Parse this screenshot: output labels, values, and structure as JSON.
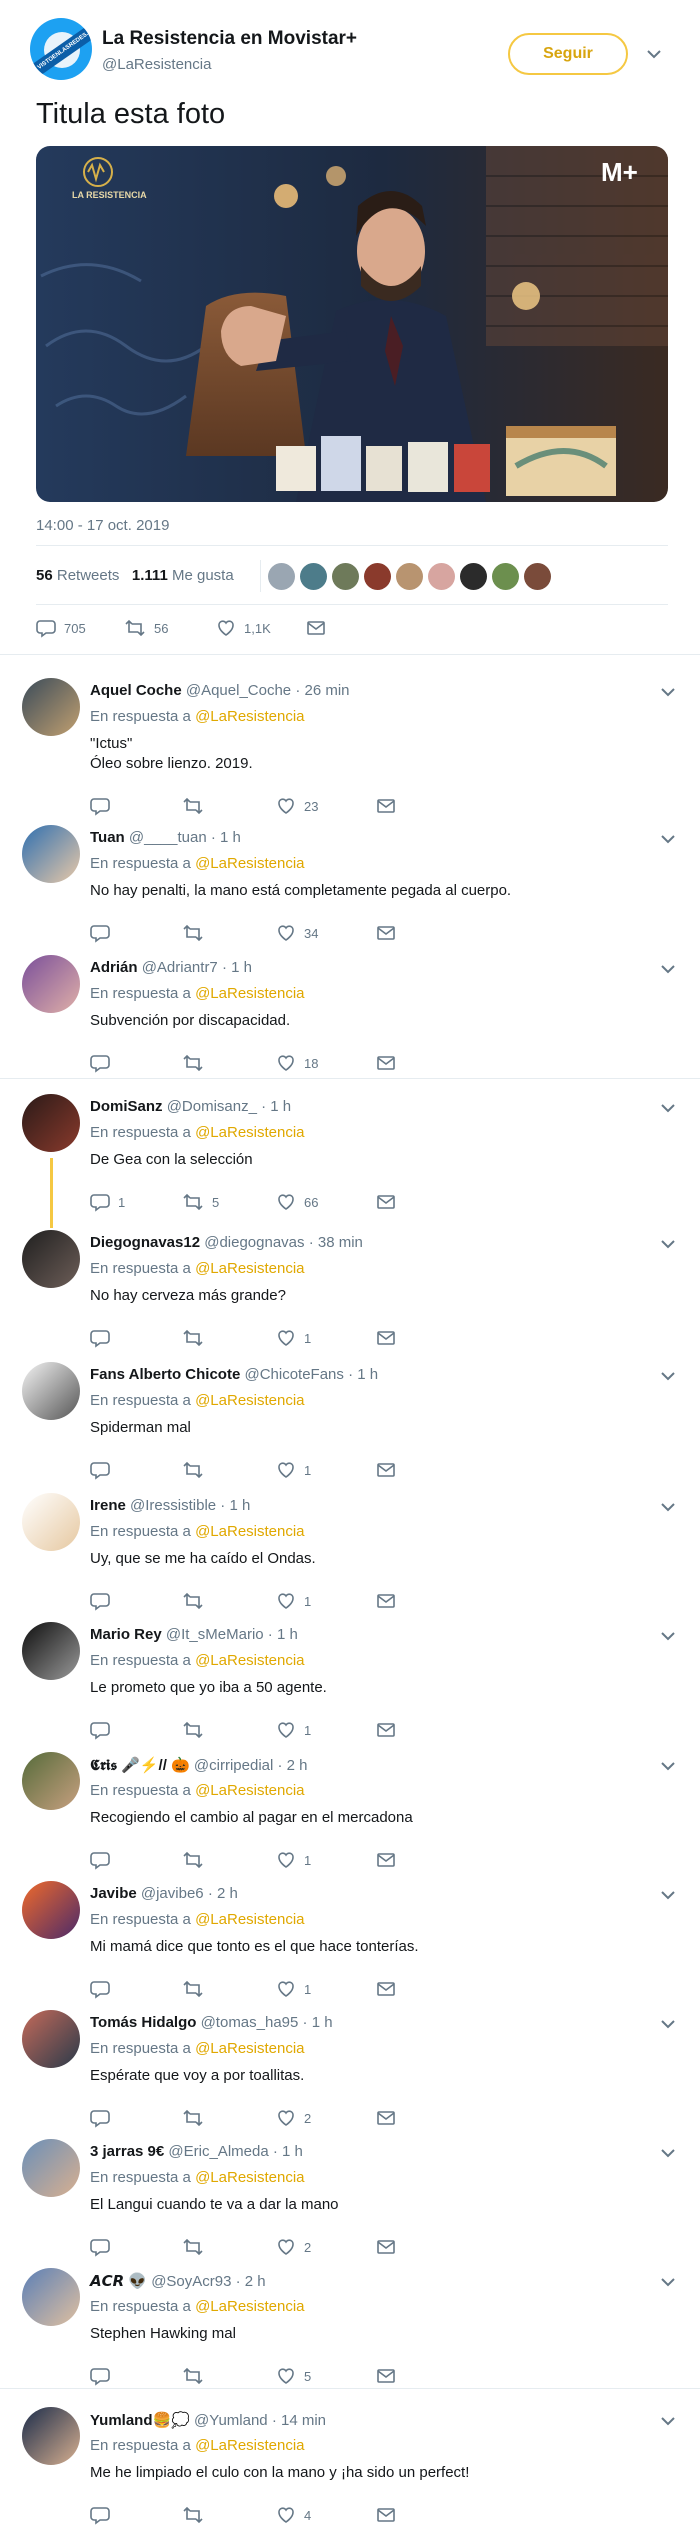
{
  "header": {
    "account_name": "La Resistencia en Movistar+",
    "handle": "@LaResistencia",
    "follow_label": "Seguir",
    "avatar_text": "VISTOENLASREDES.COM",
    "avatar_icon": "la-resistencia-logo"
  },
  "tweet": {
    "text": "Titula esta foto",
    "photo_brand": "LA RESISTENCIA",
    "photo_corner_logo": "M+",
    "timestamp": "14:00 - 17 oct. 2019",
    "retweets_count": "56",
    "retweets_label": "Retweets",
    "likes_count": "1.111",
    "likes_label": "Me gusta",
    "replies_action": "705",
    "retweets_action": "56",
    "likes_action": "1,1K"
  },
  "colors": {
    "accent": "#e0a800",
    "follow_border": "#f5c842",
    "text_primary": "#14171a",
    "text_secondary": "#657786",
    "separator": "#e6ecf0"
  },
  "in_reply_label": "En respuesta a",
  "mention": "@LaResistencia",
  "replies": [
    {
      "name": "Aquel Coche",
      "handle": "@Aquel_Coche",
      "time": "· 26 min",
      "lines": [
        "\"Ictus\"",
        "Óleo sobre lienzo. 2019."
      ],
      "replies": "",
      "retweets": "",
      "likes": "23"
    },
    {
      "name": "Tuan",
      "handle": "@____tuan",
      "time": "· 1 h",
      "lines": [
        "No hay penalti, la mano está completamente pegada al cuerpo."
      ],
      "replies": "",
      "retweets": "",
      "likes": "34"
    },
    {
      "name": "Adrián",
      "handle": "@Adriantr7",
      "time": "· 1 h",
      "lines": [
        "Subvención por discapacidad."
      ],
      "replies": "",
      "retweets": "",
      "likes": "18"
    },
    {
      "name": "DomiSanz",
      "handle": "@Domisanz_",
      "time": "· 1 h",
      "lines": [
        "De Gea con la selección"
      ],
      "replies": "1",
      "retweets": "5",
      "likes": "66"
    },
    {
      "name": "Diegognavas12",
      "handle": "@diegognavas",
      "time": "· 38 min",
      "lines": [
        "No hay cerveza más grande?"
      ],
      "replies": "",
      "retweets": "",
      "likes": "1"
    },
    {
      "name": "Fans Alberto Chicote",
      "handle": "@ChicoteFans",
      "time": "· 1 h",
      "lines": [
        "Spiderman mal"
      ],
      "replies": "",
      "retweets": "",
      "likes": "1"
    },
    {
      "name": "Irene",
      "handle": "@Iressistible",
      "time": "· 1 h",
      "lines": [
        "Uy, que se me ha caído el Ondas."
      ],
      "replies": "",
      "retweets": "",
      "likes": "1"
    },
    {
      "name": "Mario Rey",
      "handle": "@It_sMeMario",
      "time": "· 1 h",
      "lines": [
        "Le prometo que yo iba a 50 agente."
      ],
      "replies": "",
      "retweets": "",
      "likes": "1"
    },
    {
      "name": "𝕮𝖗𝖎𝖘 🎤⚡️// 🎃",
      "handle": "@cirripedial",
      "time": "· 2 h",
      "lines": [
        "Recogiendo el cambio al pagar en el mercadona"
      ],
      "replies": "",
      "retweets": "",
      "likes": "1"
    },
    {
      "name": "Javibe",
      "handle": "@javibe6",
      "time": "· 2 h",
      "lines": [
        "Mi mamá dice que tonto es el que hace tonterías."
      ],
      "replies": "",
      "retweets": "",
      "likes": "1"
    },
    {
      "name": "Tomás Hidalgo",
      "handle": "@tomas_ha95",
      "time": "· 1 h",
      "lines": [
        "Espérate que voy a por toallitas."
      ],
      "replies": "",
      "retweets": "",
      "likes": "2"
    },
    {
      "name": "3 jarras 9€",
      "handle": "@Eric_Almeda",
      "time": "· 1 h",
      "lines": [
        "El Langui cuando te va a dar la mano"
      ],
      "replies": "",
      "retweets": "",
      "likes": "2"
    },
    {
      "name": "𝘼𝘾𝙍 👽",
      "handle": "@SoyAcr93",
      "time": "· 2 h",
      "lines": [
        "Stephen Hawking mal"
      ],
      "replies": "",
      "retweets": "",
      "likes": "5"
    },
    {
      "name": "Yumland🍔💭",
      "handle": "@Yumland",
      "time": "· 14 min",
      "lines": [
        "Me he limpiado el culo con la mano y ¡ha sido un perfect!"
      ],
      "replies": "",
      "retweets": "",
      "likes": "4"
    }
  ]
}
